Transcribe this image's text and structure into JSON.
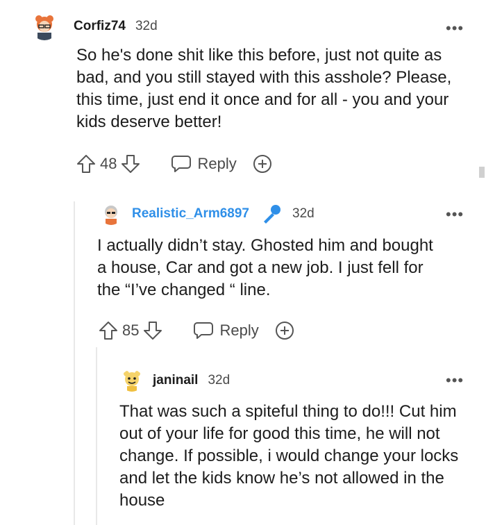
{
  "comments": [
    {
      "username": "Corfiz74",
      "age": "32d",
      "body": "So he's done shit like this before, just not quite as bad, and you still stayed with this asshole? Please, this time, just end it once and for all - you and your kids deserve better!",
      "votes": "48",
      "reply_label": "Reply"
    },
    {
      "username": "Realistic_Arm6897",
      "age": "32d",
      "body": "I actually didn’t stay. Ghosted him and bought a house, Car and got a new job. I just fell for the “I’ve changed “ line.",
      "votes": "85",
      "reply_label": "Reply"
    },
    {
      "username": "janinail",
      "age": "32d",
      "body": "That was such a spiteful thing to do!!! Cut him out of your life for good this time, he will not change. If possible, i would change your locks and let the kids know he’s not allowed in the house"
    }
  ],
  "menu_glyph": "•••",
  "colors": {
    "op_username": "#2f8fe8",
    "text": "#1c1c1c",
    "muted": "#4a4a4a",
    "thread_line": "#e8e8e8"
  }
}
